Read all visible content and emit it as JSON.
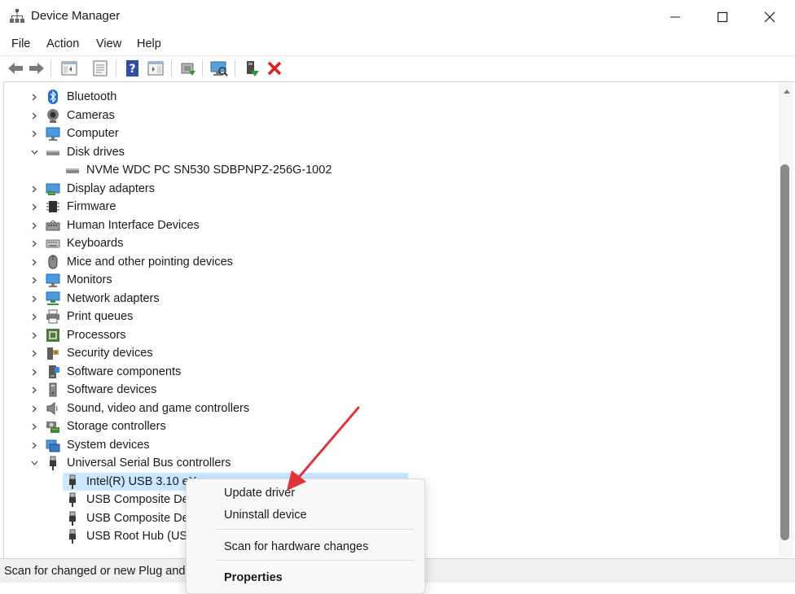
{
  "window": {
    "title": "Device Manager"
  },
  "menu": [
    "File",
    "Action",
    "View",
    "Help"
  ],
  "toolbar_icons": [
    "back-arrow-icon",
    "forward-arrow-icon",
    "show-hide-console-tree-icon",
    "properties-icon",
    "help-icon",
    "action-pane-icon",
    "update-driver-icon",
    "scan-hardware-icon",
    "enable-device-icon",
    "uninstall-icon"
  ],
  "tree": [
    {
      "label": "Bluetooth",
      "icon": "bluetooth-icon",
      "expanded": false
    },
    {
      "label": "Cameras",
      "icon": "camera-icon",
      "expanded": false
    },
    {
      "label": "Computer",
      "icon": "computer-icon",
      "expanded": false
    },
    {
      "label": "Disk drives",
      "icon": "disk-drive-icon",
      "expanded": true
    },
    {
      "label": "NVMe WDC PC SN530 SDBPNPZ-256G-1002",
      "icon": "disk-drive-icon",
      "child": true
    },
    {
      "label": "Display adapters",
      "icon": "display-adapter-icon",
      "expanded": false
    },
    {
      "label": "Firmware",
      "icon": "firmware-icon",
      "expanded": false
    },
    {
      "label": "Human Interface Devices",
      "icon": "hid-icon",
      "expanded": false
    },
    {
      "label": "Keyboards",
      "icon": "keyboard-icon",
      "expanded": false
    },
    {
      "label": "Mice and other pointing devices",
      "icon": "mouse-icon",
      "expanded": false
    },
    {
      "label": "Monitors",
      "icon": "monitor-icon",
      "expanded": false
    },
    {
      "label": "Network adapters",
      "icon": "network-adapter-icon",
      "expanded": false
    },
    {
      "label": "Print queues",
      "icon": "printer-icon",
      "expanded": false
    },
    {
      "label": "Processors",
      "icon": "processor-icon",
      "expanded": false
    },
    {
      "label": "Security devices",
      "icon": "security-device-icon",
      "expanded": false
    },
    {
      "label": "Software components",
      "icon": "software-component-icon",
      "expanded": false
    },
    {
      "label": "Software devices",
      "icon": "software-device-icon",
      "expanded": false
    },
    {
      "label": "Sound, video and game controllers",
      "icon": "speaker-icon",
      "expanded": false
    },
    {
      "label": "Storage controllers",
      "icon": "storage-controller-icon",
      "expanded": false
    },
    {
      "label": "System devices",
      "icon": "system-device-icon",
      "expanded": false
    },
    {
      "label": "Universal Serial Bus controllers",
      "icon": "usb-icon",
      "expanded": true
    },
    {
      "label": "Intel(R) USB 3.10 eX",
      "icon": "usb-icon",
      "child": true,
      "selected": true
    },
    {
      "label": "USB Composite De",
      "icon": "usb-icon",
      "child": true
    },
    {
      "label": "USB Composite De",
      "icon": "usb-icon",
      "child": true
    },
    {
      "label": "USB Root Hub (USE",
      "icon": "usb-icon",
      "child": true
    }
  ],
  "context_menu": {
    "update": "Update driver",
    "uninstall": "Uninstall device",
    "scan": "Scan for hardware changes",
    "properties": "Properties"
  },
  "status": "Scan for changed or new Plug and",
  "colors": {
    "selection": "#cce8ff",
    "annotation_arrow": "#e0333c",
    "scroll_thumb": "#8a8a8a"
  }
}
